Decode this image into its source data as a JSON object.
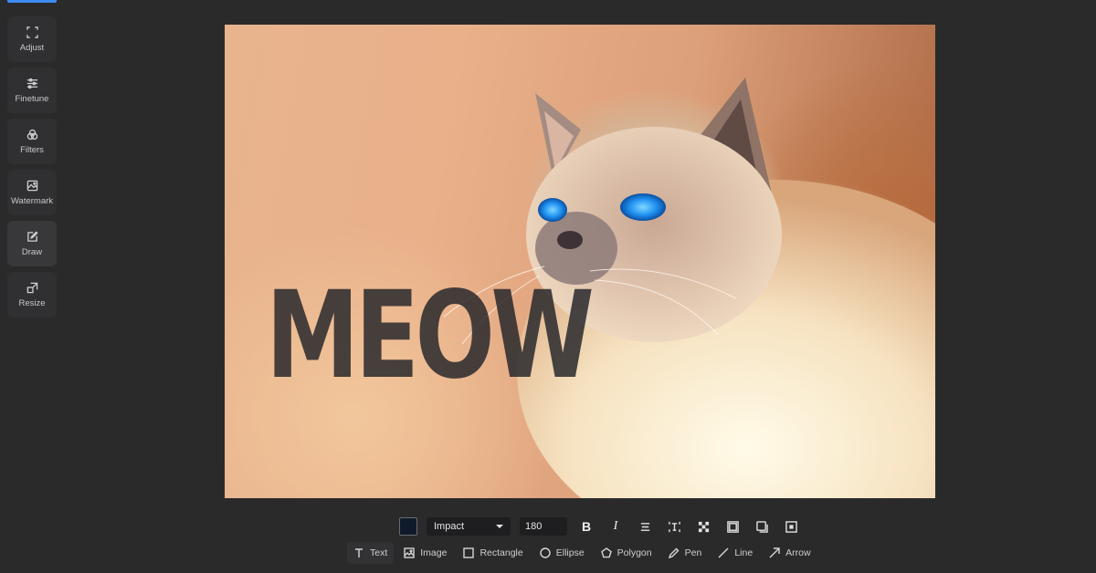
{
  "sidebar": {
    "items": [
      {
        "label": "Adjust",
        "icon": "crop-icon"
      },
      {
        "label": "Finetune",
        "icon": "sliders-icon"
      },
      {
        "label": "Filters",
        "icon": "filters-icon"
      },
      {
        "label": "Watermark",
        "icon": "watermark-icon"
      },
      {
        "label": "Draw",
        "icon": "pencil-icon",
        "active": true
      },
      {
        "label": "Resize",
        "icon": "resize-icon"
      }
    ]
  },
  "canvas": {
    "overlay_text": "MEOW"
  },
  "text_props": {
    "color": "#0f1b2b",
    "font": "Impact",
    "size": "180",
    "bold_label": "B",
    "italic_label": "I"
  },
  "tools": {
    "items": [
      {
        "label": "Text",
        "icon": "text-icon",
        "active": true
      },
      {
        "label": "Image",
        "icon": "image-icon"
      },
      {
        "label": "Rectangle",
        "icon": "rectangle-icon"
      },
      {
        "label": "Ellipse",
        "icon": "ellipse-icon"
      },
      {
        "label": "Polygon",
        "icon": "polygon-icon"
      },
      {
        "label": "Pen",
        "icon": "pen-icon"
      },
      {
        "label": "Line",
        "icon": "line-icon"
      },
      {
        "label": "Arrow",
        "icon": "arrow-icon"
      }
    ]
  },
  "colors": {
    "accent": "#3d8bf2",
    "background": "#2a2a2b"
  }
}
